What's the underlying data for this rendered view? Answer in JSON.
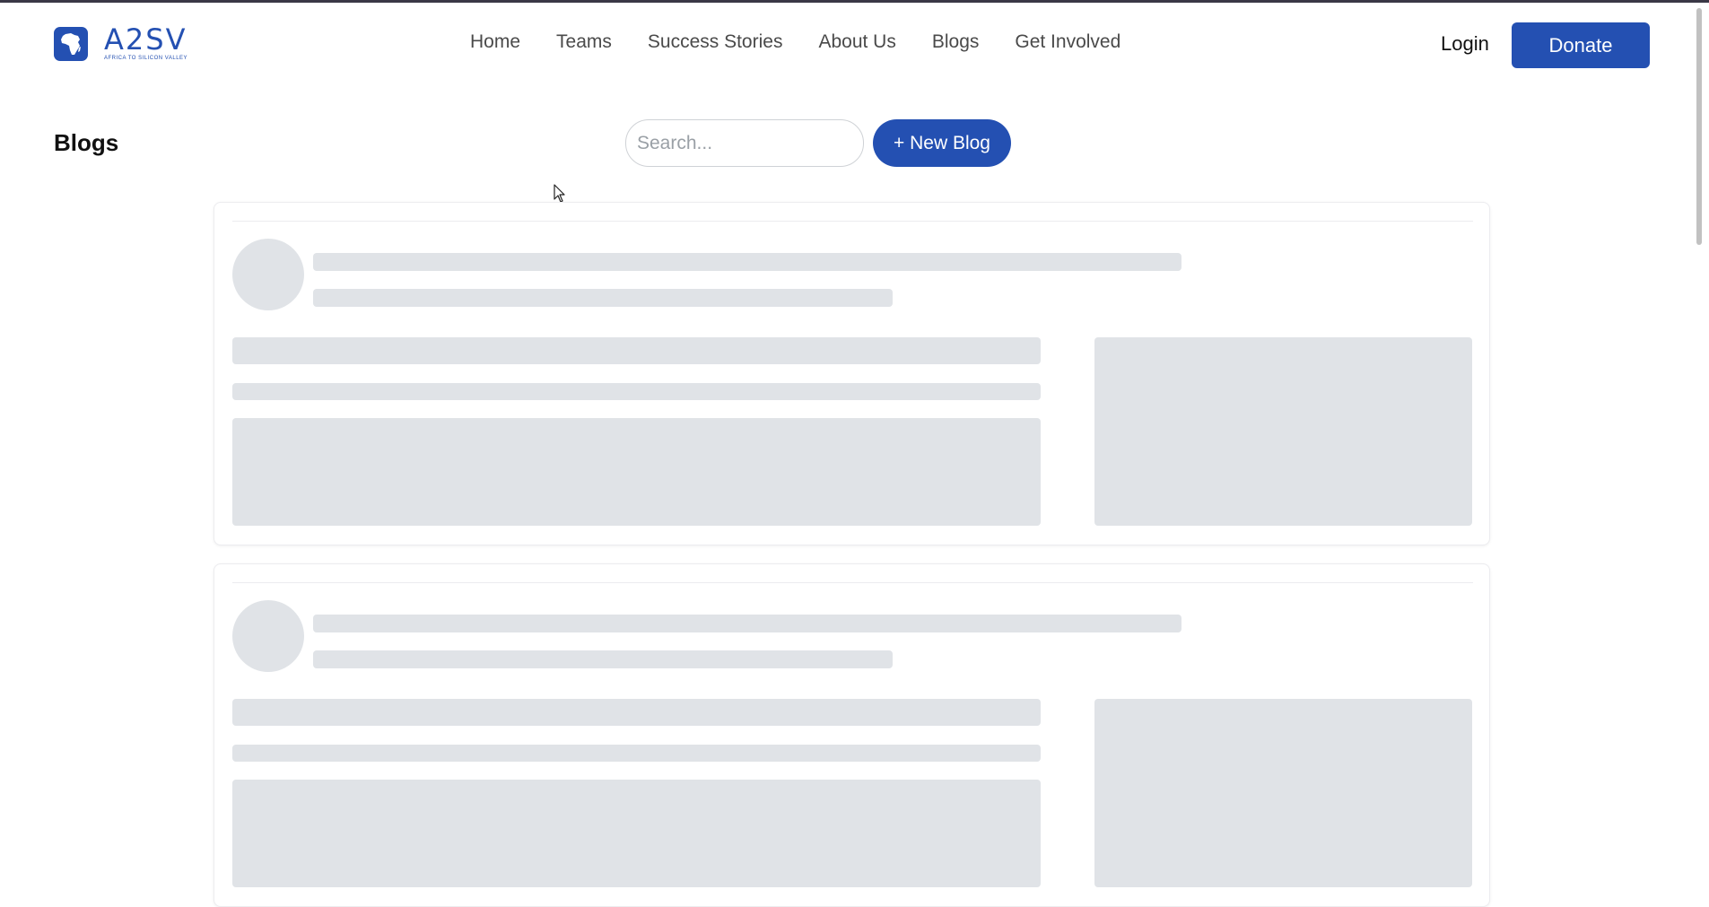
{
  "brand": {
    "name": "A2SV",
    "tagline": "AFRICA TO SILICON VALLEY",
    "accent_color": "#2450b2"
  },
  "nav": {
    "links": [
      "Home",
      "Teams",
      "Success Stories",
      "About Us",
      "Blogs",
      "Get Involved"
    ],
    "login_label": "Login",
    "donate_label": "Donate"
  },
  "page": {
    "title": "Blogs",
    "search_placeholder": "Search...",
    "new_blog_label": "+ New Blog"
  },
  "skeleton": {
    "card_count": 2,
    "placeholder_color": "#e0e3e7"
  },
  "icons": {
    "logo": "africa-map-icon",
    "cursor": "mouse-pointer-icon"
  }
}
